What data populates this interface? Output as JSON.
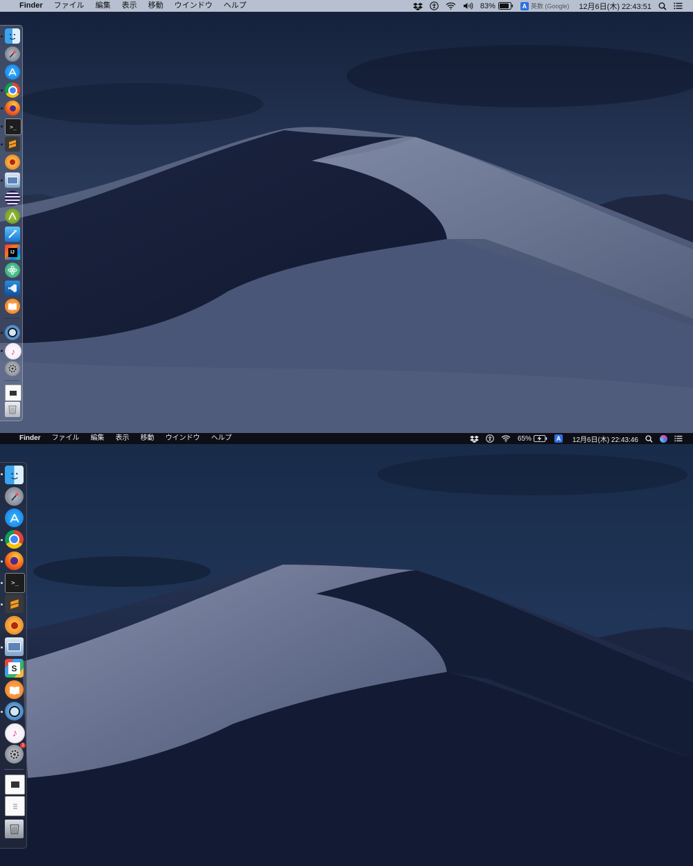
{
  "screens": [
    {
      "menubar": {
        "apple": "",
        "app_name": "Finder",
        "menus": [
          "ファイル",
          "編集",
          "表示",
          "移動",
          "ウインドウ",
          "ヘルプ"
        ],
        "battery": "83%",
        "ime_letter": "A",
        "ime_label": "英数 (Google)",
        "datetime": "12月6日(木)  22:43:51"
      }
    },
    {
      "menubar": {
        "apple": "",
        "app_name": "Finder",
        "menus": [
          "ファイル",
          "編集",
          "表示",
          "移動",
          "ウインドウ",
          "ヘルプ"
        ],
        "battery": "65%",
        "ime_letter": "A",
        "datetime": "12月6日(木)  22:43:46"
      },
      "dock_badge": "1"
    }
  ]
}
